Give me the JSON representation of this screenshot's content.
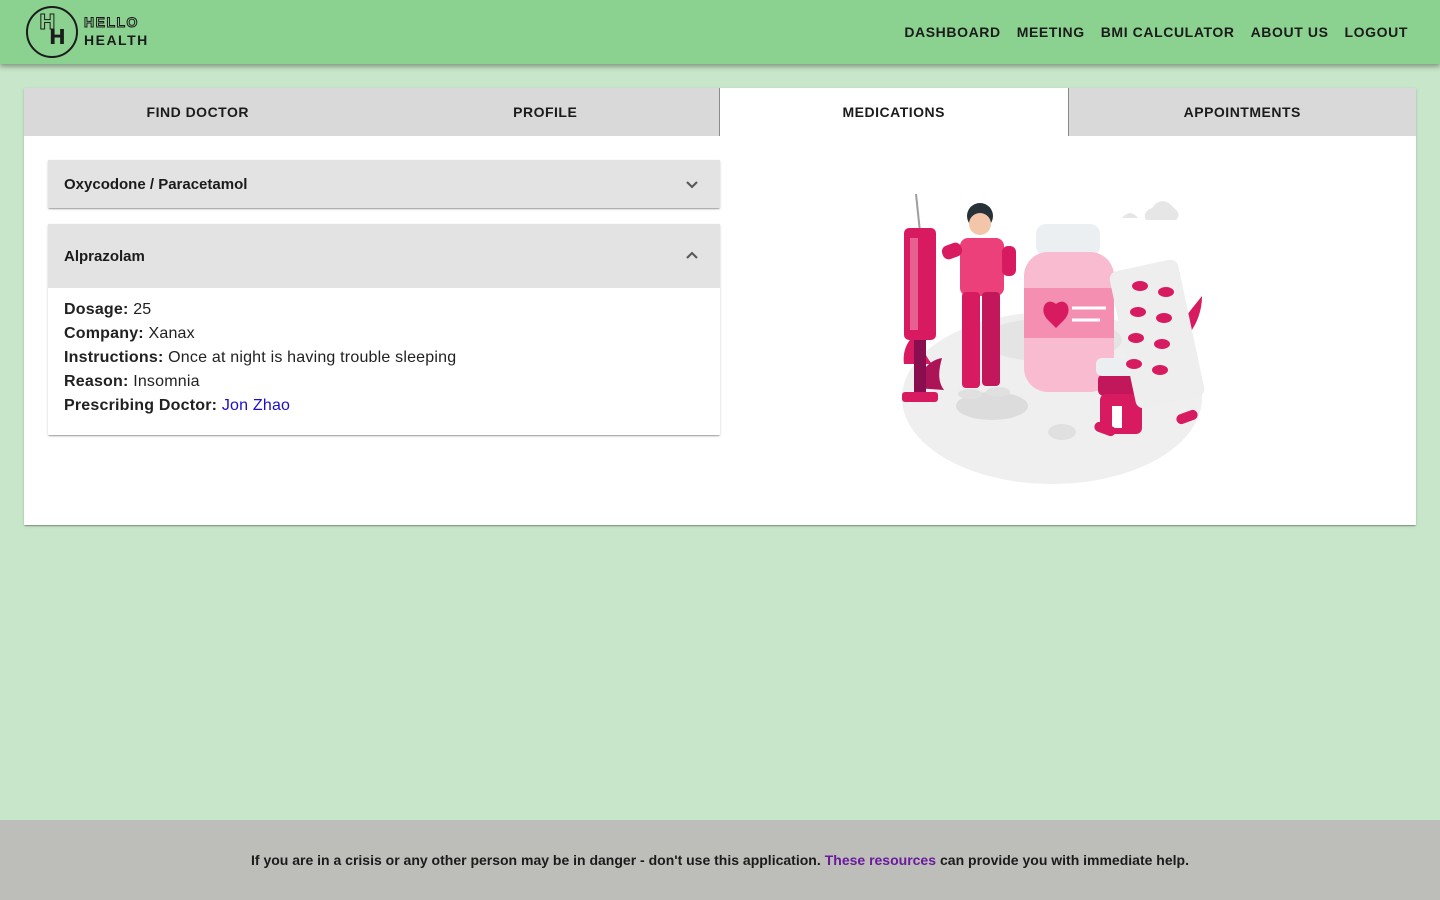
{
  "app": {
    "logo_initials": "HH",
    "logo_line1": "HELLO",
    "logo_line2": "HEALTH"
  },
  "nav": {
    "items": [
      "DASHBOARD",
      "MEETING",
      "BMI CALCULATOR",
      "ABOUT US",
      "LOGOUT"
    ]
  },
  "tabs": {
    "items": [
      "FIND DOCTOR",
      "PROFILE",
      "MEDICATIONS",
      "APPOINTMENTS"
    ],
    "active": "MEDICATIONS"
  },
  "medications": [
    {
      "name": "Oxycodone / Paracetamol",
      "expanded": false
    },
    {
      "name": "Alprazolam",
      "expanded": true,
      "dosage_label": "Dosage:",
      "dosage": "25",
      "company_label": "Company:",
      "company": "Xanax",
      "instructions_label": "Instructions:",
      "instructions": "Once at night is having trouble sleeping",
      "reason_label": "Reason:",
      "reason": "Insomnia",
      "doctor_label": "Prescribing Doctor:",
      "doctor": "Jon Zhao"
    }
  ],
  "footer": {
    "text_before": "If you are in a crisis or any other person may be in danger - don't use this application.",
    "link_text": "These resources",
    "text_after": "can provide you with immediate help."
  },
  "colors": {
    "header_bg": "#8bd291",
    "page_bg": "#c8e6c9",
    "accent": "#d81b60",
    "link": "#1a0dcc",
    "footer_link": "#6a1a9a"
  },
  "icons": {
    "collapsed": "chevron-down-icon",
    "expanded": "chevron-up-icon"
  }
}
